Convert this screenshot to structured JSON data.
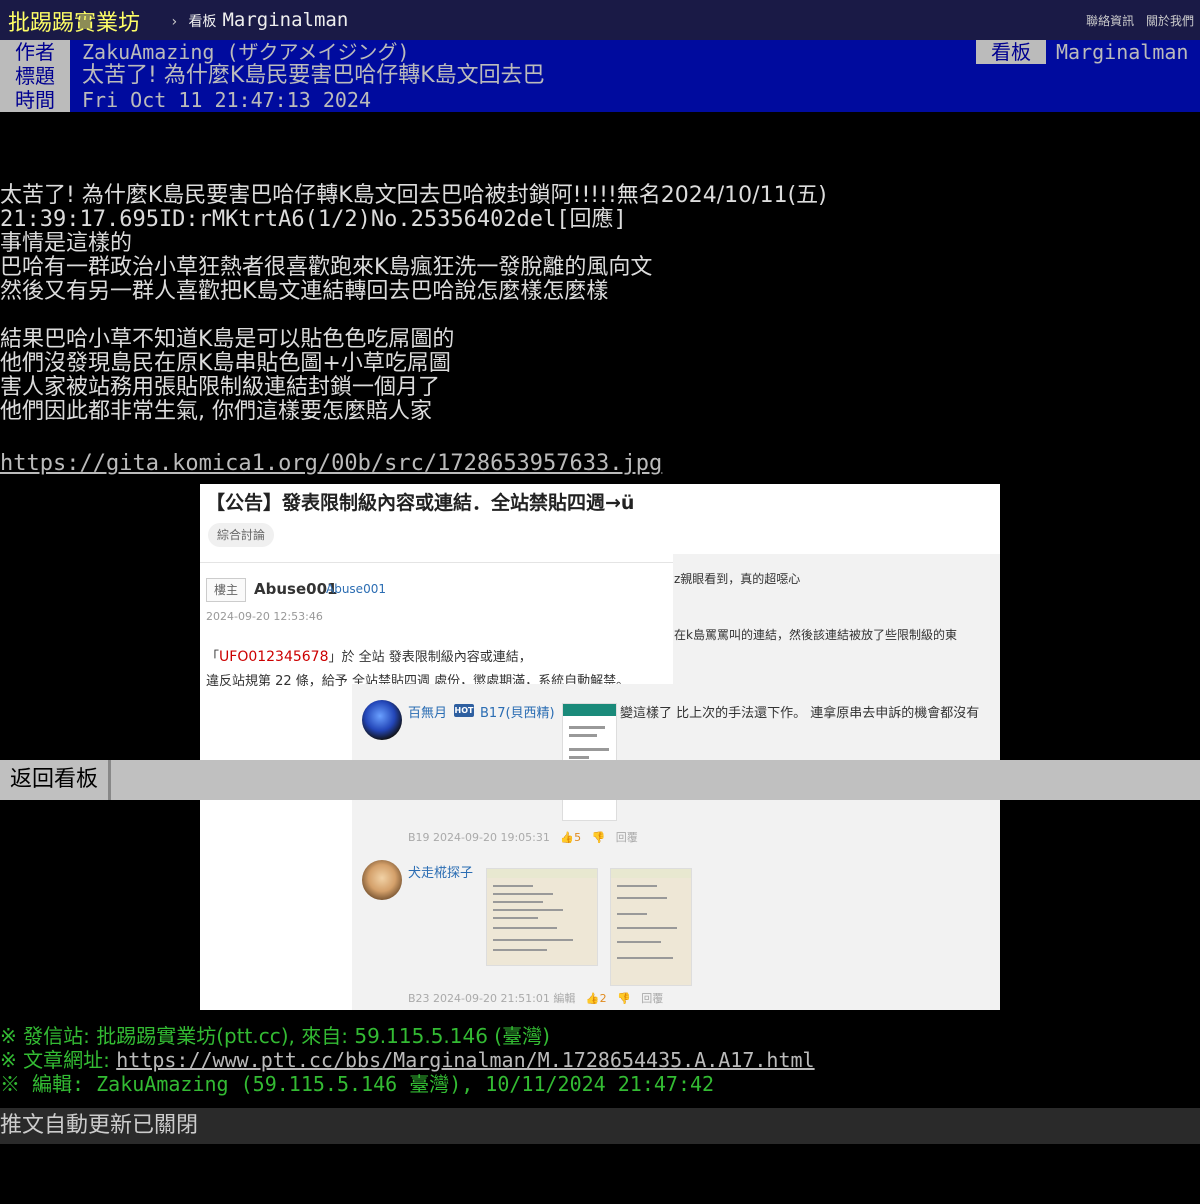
{
  "topbar": {
    "site_name": "批踢踢實業坊",
    "separator": "›",
    "board_label": "看板",
    "board_name": "Marginalman",
    "contact": "聯絡資訊",
    "about": "關於我們"
  },
  "meta": {
    "author_label": "作者",
    "author": "ZakuAmazing (ザクアメイジング)",
    "title_label": "標題",
    "title": "太苦了! 為什麼K島民要害巴哈仔轉K島文回去巴",
    "time_label": "時間",
    "time": "Fri Oct 11 21:47:13 2024",
    "board_label": "看板",
    "board": "Marginalman"
  },
  "content": {
    "lines": [
      "太苦了! 為什麼K島民要害巴哈仔轉K島文回去巴哈被封鎖阿!!!!!無名2024/10/11(五)",
      "21:39:17.695ID:rMKtrtA6(1/2)No.25356402del[回應]",
      "事情是這樣的",
      "巴哈有一群政治小草狂熱者很喜歡跑來K島瘋狂洗一發脫離的風向文",
      "然後又有另一群人喜歡把K島文連結轉回去巴哈說怎麼樣怎麼樣",
      "",
      "結果巴哈小草不知道K島是可以貼色色吃屌圖的",
      "他們沒發現島民在原K島串貼色圖+小草吃屌圖",
      "害人家被站務用張貼限制級連結封鎖一個月了",
      "他們因此都非常生氣, 你們這樣要怎麼賠人家"
    ],
    "image_link": "https://gita.komica1.org/00b/src/1728653957633.jpg"
  },
  "screenshot": {
    "title": "【公告】發表限制級內容或連結．全站禁貼四週→ü",
    "tag": "綜合討論",
    "op_badge": "樓主",
    "op_name": "Abuse001",
    "op_id": "Abuse001",
    "op_time": "2024-09-20 12:53:46",
    "notice_quote_open": "「",
    "notice_user": "UFO012345678",
    "notice_rest": "」於 全站 發表限制級內容或連結，",
    "notice_line2": "違反站規第 22 條，給予 全站禁貼四週 處份，懲處期滿，系統自動解禁。",
    "right_line1": "z親眼看到，真的超噁心",
    "right_line2": "在k島罵罵叫的連結，然後該連結被放了些限制級的東",
    "c1_name": "百無月",
    "c1_hot": "HOT",
    "c1_floor": "B17(貝西精)",
    "c1_text": "變這樣了 比上次的手法還下作。 連拿原串去申訴的機會都沒有",
    "c1_meta_floor": "B19",
    "c1_meta_time": "2024-09-20 19:05:31",
    "c1_likes": "5",
    "c1_reply": "回覆",
    "c2_name": "犬走椛探子",
    "c2_meta_floor": "B23",
    "c2_meta_time": "2024-09-20 21:51:01",
    "c2_edit": "編輯",
    "c2_likes": "2",
    "c2_reply": "回覆"
  },
  "back_button": "返回看板",
  "footer": {
    "line1": "※ 發信站: 批踢踢實業坊(ptt.cc), 來自: 59.115.5.146 (臺灣)",
    "line2_prefix": "※ 文章網址: ",
    "line2_url": "https://www.ptt.cc/bbs/Marginalman/M.1728654435.A.A17.html",
    "line3": "※ 編輯: ZakuAmazing (59.115.5.146 臺灣), 10/11/2024 21:47:42"
  },
  "push_status": "推文自動更新已關閉",
  "colors": {
    "topbar_bg": "#1a1a46",
    "meta_bg": "#000b9e",
    "site_name": "#ffff66",
    "signature_green": "#33bb33"
  }
}
